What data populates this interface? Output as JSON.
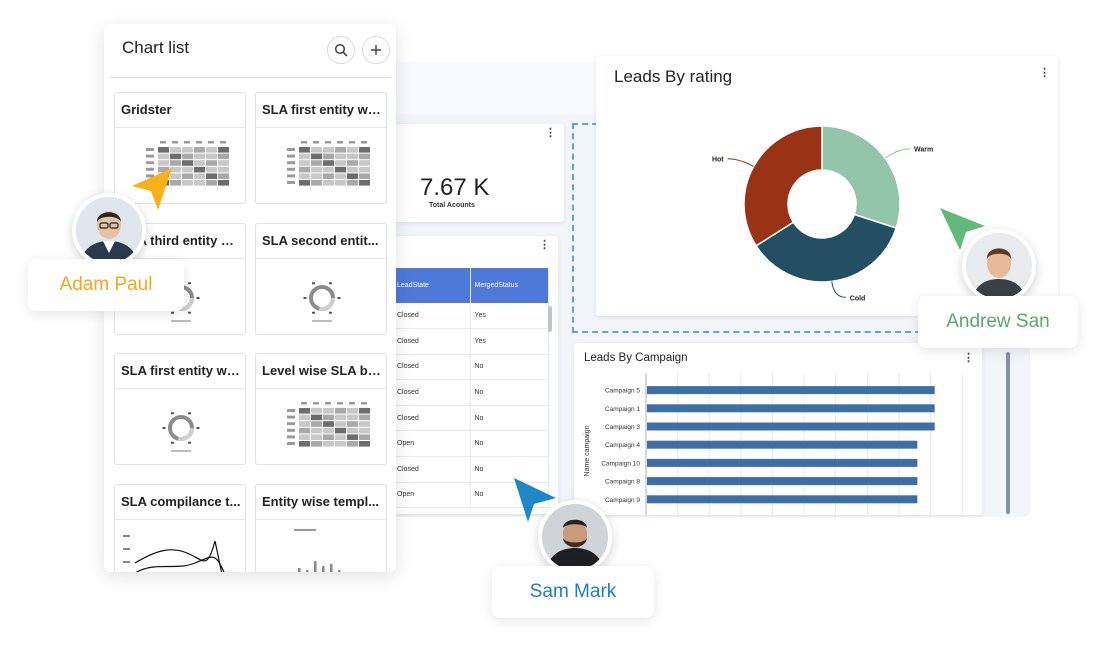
{
  "chart_list": {
    "title": "Chart list",
    "search_icon": "search-icon",
    "add_icon": "plus-icon",
    "tiles": [
      {
        "title": "Gridster",
        "thumb": "grid"
      },
      {
        "title": "SLA first entity wi...",
        "thumb": "grid"
      },
      {
        "title": "SLA third entity w...",
        "thumb": "ring"
      },
      {
        "title": "SLA second entit...",
        "thumb": "ring"
      },
      {
        "title": "SLA first entity wi...",
        "thumb": "ring"
      },
      {
        "title": "Level wise SLA br...",
        "thumb": "grid"
      },
      {
        "title": "SLA compilance t...",
        "thumb": "line"
      },
      {
        "title": "Entity wise templ...",
        "thumb": "bars"
      }
    ]
  },
  "total_accounts": {
    "value": "7.67 K",
    "label": "Total Acounts"
  },
  "lead_table": {
    "columns": [
      "LeadState",
      "MergedStatus"
    ],
    "rows": [
      [
        "Closed",
        "Yes"
      ],
      [
        "Closed",
        "Yes"
      ],
      [
        "Closed",
        "No"
      ],
      [
        "Closed",
        "No"
      ],
      [
        "Closed",
        "No"
      ],
      [
        "Open",
        "No"
      ],
      [
        "Closed",
        "No"
      ],
      [
        "Open",
        "No"
      ]
    ],
    "header_color": "#4f79d9"
  },
  "chart_data": [
    {
      "type": "pie",
      "title": "Leads By rating",
      "categories": [
        "Warm",
        "Cold",
        "Hot"
      ],
      "values": [
        30,
        36,
        34
      ],
      "colors": [
        "#92c5a9",
        "#244e63",
        "#9a3216"
      ],
      "donut": true
    },
    {
      "type": "bar",
      "orientation": "horizontal",
      "title": "Leads By Campaign",
      "ylabel": "Name campaign",
      "categories": [
        "Campaign 5",
        "Campaign 1",
        "Campaign 3",
        "Campaign 4",
        "Campaign 10",
        "Campaign 8",
        "Campaign 9"
      ],
      "values": [
        100,
        100,
        100,
        94,
        94,
        94,
        94
      ],
      "xlim": [
        0,
        115
      ],
      "color": "#3d6fa6"
    }
  ],
  "users": [
    {
      "name": "Adam Paul",
      "color": "#f5a623"
    },
    {
      "name": "Andrew San",
      "color": "#5ba86e"
    },
    {
      "name": "Sam Mark",
      "color": "#1f7fb8"
    }
  ]
}
